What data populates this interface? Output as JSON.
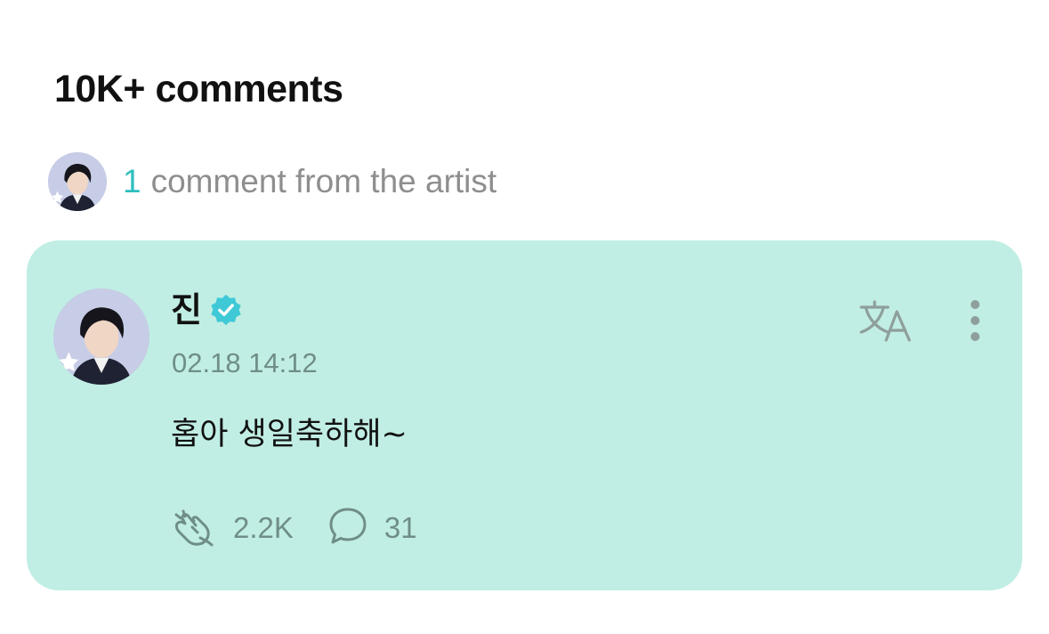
{
  "header": {
    "title": "10K+ comments"
  },
  "artist_summary": {
    "count": "1",
    "text": "comment from the artist"
  },
  "comment": {
    "author": "진",
    "verified": true,
    "timestamp": "02.18 14:12",
    "body": "홉아 생일축하해~",
    "likes": "2.2K",
    "replies": "31"
  },
  "colors": {
    "card_background": "#c1eee4",
    "accent_teal": "#2fbfbf",
    "verified_badge": "#3fc9d6",
    "muted_text": "#8e8e8e",
    "icon_gray": "#6f8e88"
  },
  "icons": {
    "translate": "translate-icon",
    "more": "more-vertical-icon",
    "like": "clapping-hands-icon",
    "reply": "speech-bubble-icon",
    "verified": "verified-badge-icon"
  }
}
